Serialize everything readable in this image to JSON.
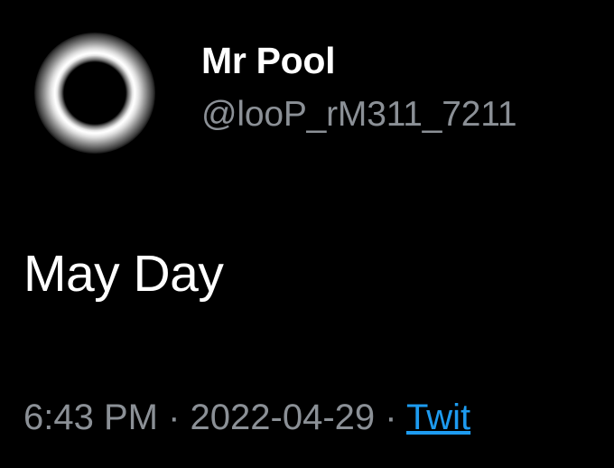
{
  "tweet": {
    "author": {
      "display_name": "Mr Pool",
      "handle": "@looP_rM311_7211",
      "avatar_icon": "solar-eclipse-avatar"
    },
    "text": "May Day",
    "time": "6:43 PM",
    "separator": "·",
    "date": "2022-04-29",
    "source": "Twit"
  },
  "colors": {
    "background": "#000000",
    "primary_text": "#ffffff",
    "secondary_text": "#8b9096",
    "link": "#1d9bf0"
  }
}
